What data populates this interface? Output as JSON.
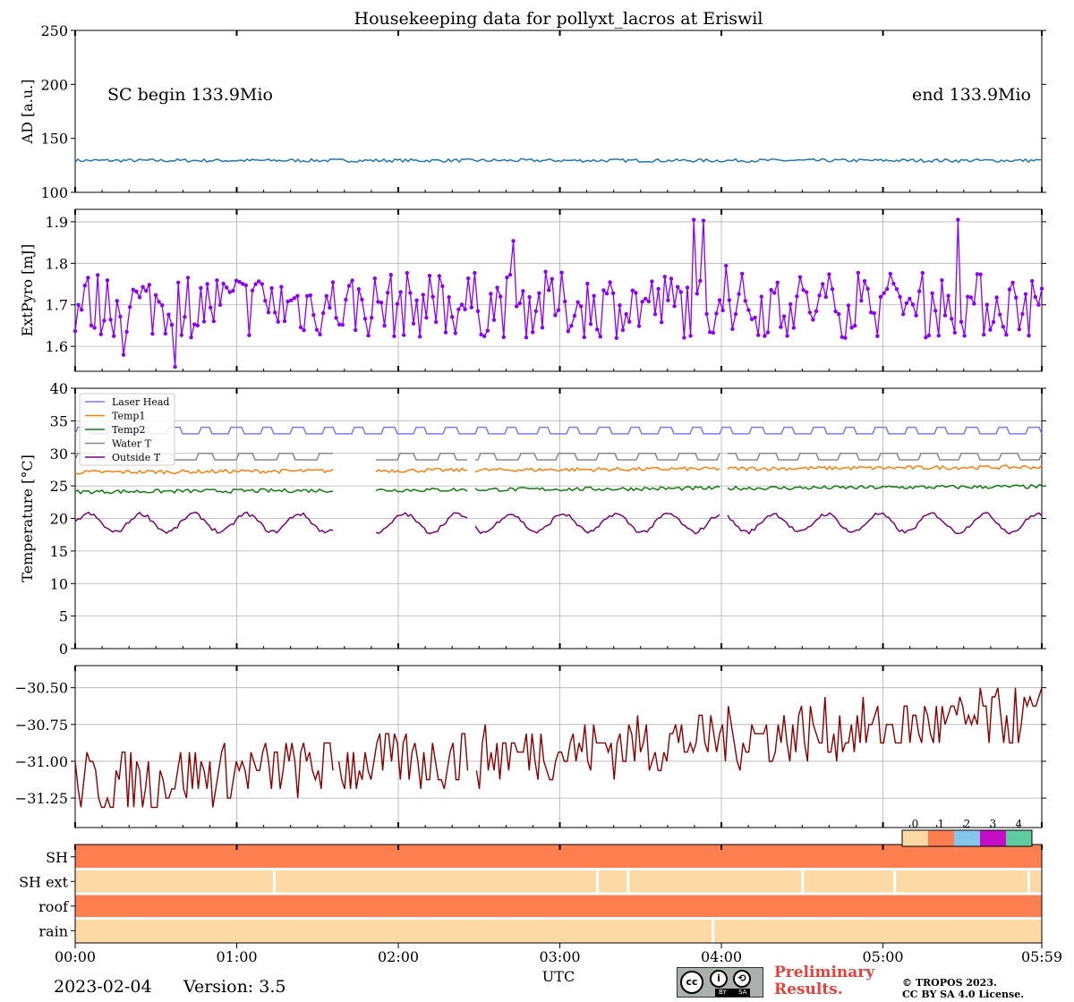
{
  "title": "Housekeeping data for pollyxt_lacros at Eriswil",
  "date": "2023-02-04",
  "version": "Version: 3.5",
  "prelim_line1": "Preliminary",
  "prelim_line2": "Results.",
  "copyright_line1": "© TROPOS 2023.",
  "copyright_line2": "CC BY SA 4.0 License.",
  "cc_badge": {
    "cc": "cc",
    "by": "BY",
    "sa": "SA"
  },
  "colors": {
    "ad": "#1f77b4",
    "pyro": "#8c00ff",
    "laser_head": "#7b7bf7",
    "temp1": "#ff7f0e",
    "temp2": "#127d12",
    "water_t": "#888888",
    "outside_t": "#7d007d",
    "tempchk": "#8b0000",
    "status_0": "#fdd9a6",
    "status_1": "#fd7f4f",
    "status_2": "#87c6ec",
    "status_3": "#c60dc6",
    "status_4": "#5fcb9e"
  },
  "chart_data": [
    {
      "type": "line",
      "panel": "ad",
      "ylabel": "AD [a.u.]",
      "ylim": [
        100,
        250
      ],
      "yticks": [
        "100",
        "150",
        "200",
        "250"
      ],
      "grid": false,
      "annotation_left": "SC begin 133.9Mio",
      "annotation_right": "end 133.9Mio",
      "series": [
        {
          "level": 129.5,
          "variation": 1.5
        }
      ]
    },
    {
      "type": "line",
      "panel": "pyro",
      "ylabel": "ExtPyro [mJ]",
      "ylim": [
        1.54,
        1.93
      ],
      "yticks": [
        "1.6",
        "1.7",
        "1.8",
        "1.9"
      ],
      "grid": true,
      "markers": true,
      "series": [
        {
          "level": 1.7,
          "min": 1.55,
          "max": 1.905
        }
      ]
    },
    {
      "type": "line",
      "panel": "temperature",
      "ylabel": "Temperature [$^\\circ C$]",
      "ylim": [
        0,
        40
      ],
      "yticks": [
        "0",
        "5",
        "10",
        "15",
        "20",
        "25",
        "30",
        "35",
        "40"
      ],
      "grid": true,
      "legend": "top-left",
      "series": [
        {
          "name": "Laser Head",
          "level": 33.5,
          "min": 33,
          "max": 34
        },
        {
          "name": "Temp1",
          "level": 27.5,
          "min": 26.8,
          "max": 28.3
        },
        {
          "name": "Temp2",
          "level": 24.5,
          "min": 23.8,
          "max": 25.2
        },
        {
          "name": "Water T",
          "level": 29.5,
          "min": 29,
          "max": 30
        },
        {
          "name": "Outside T",
          "level": 19.3,
          "min": 17.5,
          "max": 21.5
        }
      ]
    },
    {
      "type": "line",
      "panel": "tempchk",
      "ylim": [
        -31.45,
        -30.35
      ],
      "yticks": [
        "-31.25",
        "-31.00",
        "-30.75",
        "-30.50"
      ],
      "grid": true,
      "series": [
        {
          "trend_start": -31.15,
          "trend_end": -30.7,
          "min": -31.38,
          "max": -30.38
        }
      ]
    },
    {
      "type": "heatmap",
      "panel": "status",
      "rows": [
        "SH",
        "SH ext",
        "roof",
        "rain"
      ],
      "row_status": [
        1,
        0,
        1,
        0
      ],
      "colorbar_labels": [
        "0",
        "1",
        "2",
        "3",
        "4"
      ]
    }
  ],
  "x_axis": {
    "xlabel": "UTC",
    "ticks": [
      "00:00",
      "01:00",
      "02:00",
      "03:00",
      "04:00",
      "05:00",
      "05:59"
    ],
    "tick_hours": [
      0,
      1,
      2,
      3,
      4,
      5,
      5.983
    ],
    "range_hours": [
      0,
      5.983
    ]
  }
}
